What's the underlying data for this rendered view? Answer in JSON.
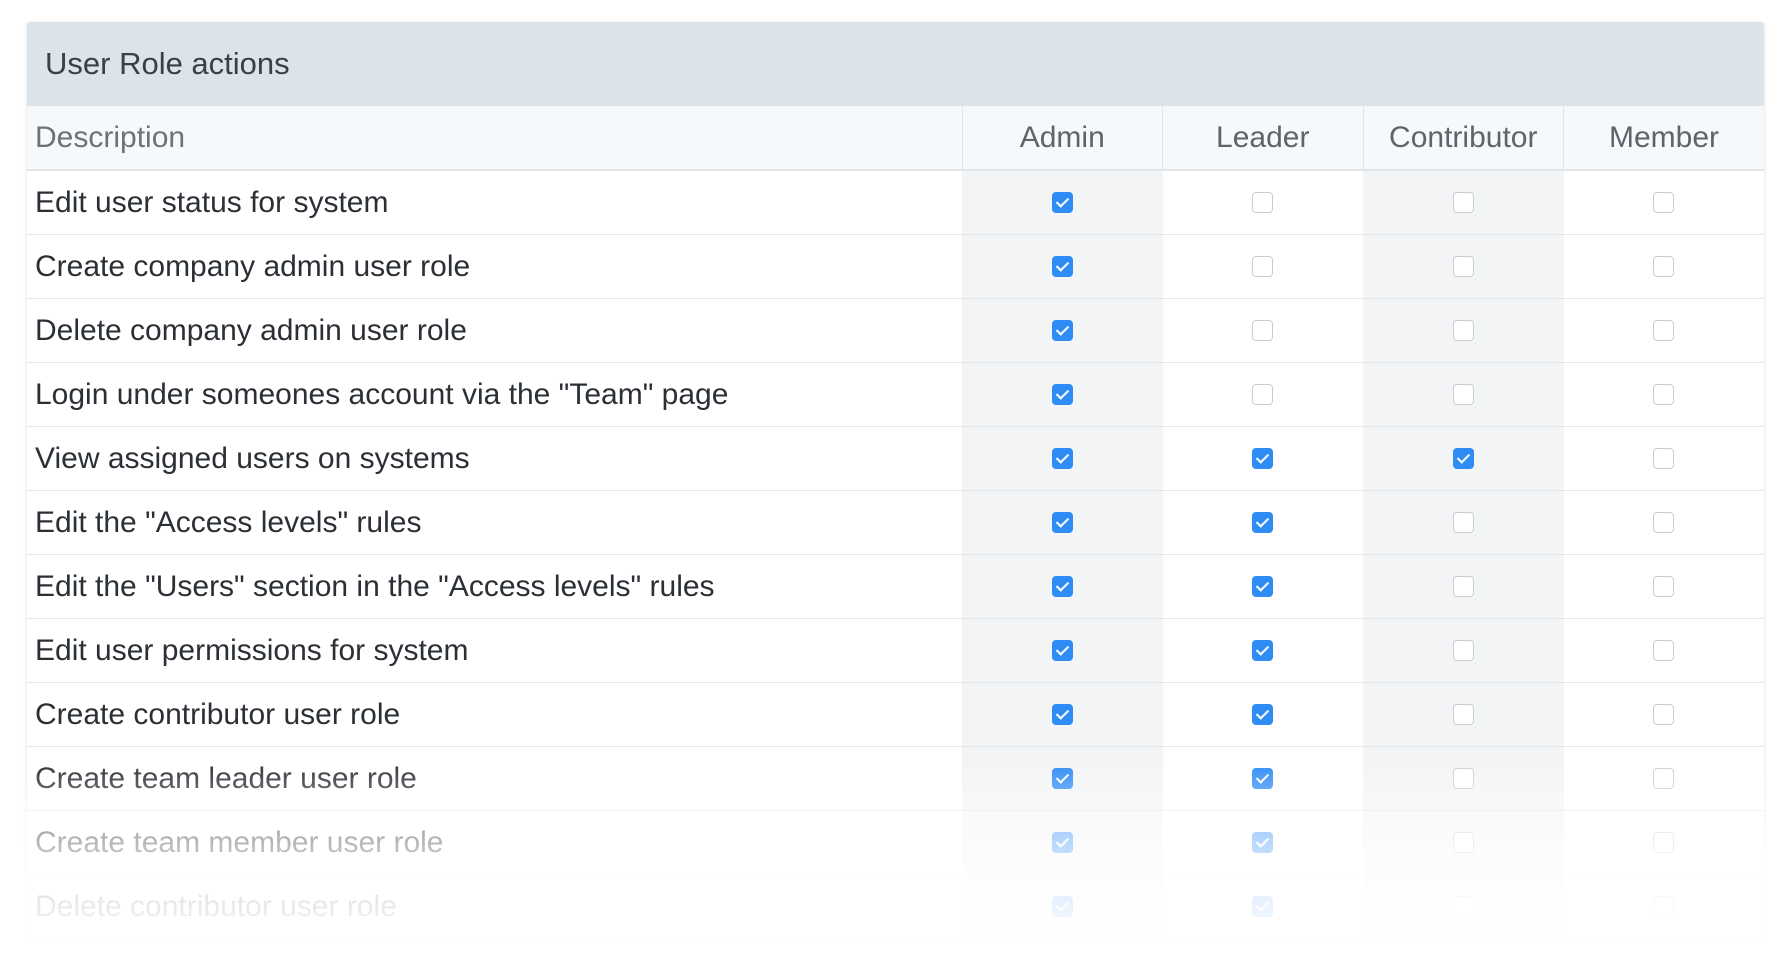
{
  "panel": {
    "title": "User Role actions"
  },
  "table": {
    "headers": [
      "Description",
      "Admin",
      "Leader",
      "Contributor",
      "Member"
    ],
    "rows": [
      {
        "description": "Edit user status for system",
        "admin": true,
        "leader": false,
        "contributor": false,
        "member": false
      },
      {
        "description": "Create company admin user role",
        "admin": true,
        "leader": false,
        "contributor": false,
        "member": false
      },
      {
        "description": "Delete company admin user role",
        "admin": true,
        "leader": false,
        "contributor": false,
        "member": false
      },
      {
        "description": "Login under someones account via the \"Team\" page",
        "admin": true,
        "leader": false,
        "contributor": false,
        "member": false
      },
      {
        "description": "View assigned users on systems",
        "admin": true,
        "leader": true,
        "contributor": true,
        "member": false
      },
      {
        "description": "Edit the \"Access levels\" rules",
        "admin": true,
        "leader": true,
        "contributor": false,
        "member": false
      },
      {
        "description": "Edit the \"Users\" section in the \"Access levels\" rules",
        "admin": true,
        "leader": true,
        "contributor": false,
        "member": false
      },
      {
        "description": "Edit user permissions for system",
        "admin": true,
        "leader": true,
        "contributor": false,
        "member": false
      },
      {
        "description": "Create contributor user role",
        "admin": true,
        "leader": true,
        "contributor": false,
        "member": false
      },
      {
        "description": "Create team leader user role",
        "admin": true,
        "leader": true,
        "contributor": false,
        "member": false
      },
      {
        "description": "Create team member user role",
        "admin": true,
        "leader": true,
        "contributor": false,
        "member": false
      },
      {
        "description": "Delete contributor user role",
        "admin": true,
        "leader": true,
        "contributor": false,
        "member": false
      }
    ]
  },
  "colors": {
    "header_bg": "#dce3e9",
    "checkbox_checked": "#2f8cf5",
    "shaded_column": "#f3f4f5"
  }
}
